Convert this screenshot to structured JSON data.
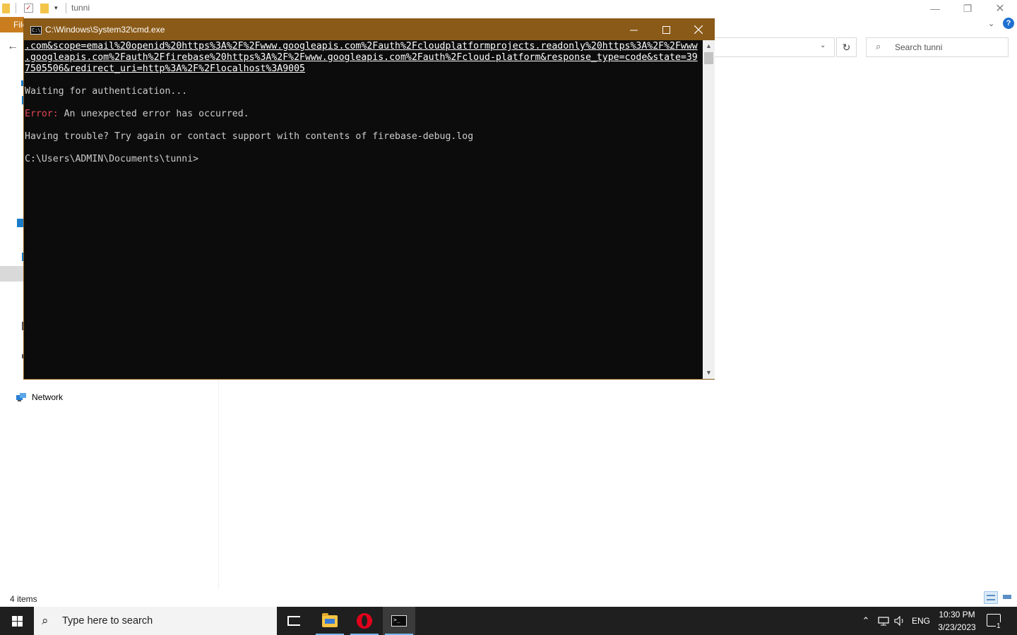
{
  "explorer": {
    "title": "tunni",
    "ribbon_file_label": "File",
    "search_placeholder": "Search tunni",
    "nav_network_label": "Network",
    "status_items": "4 items"
  },
  "cmd": {
    "title": "C:\\Windows\\System32\\cmd.exe",
    "url_line_1": ".com&scope=email%20openid%20https%3A%2F%2Fwww.googleapis.com%2Fauth%2Fcloudplatformprojects.readonly%20https%3A%2F%2Fwww",
    "url_line_2": ".googleapis.com%2Fauth%2Ffirebase%20https%3A%2F%2Fwww.googleapis.com%2Fauth%2Fcloud-platform&response_type=code&state=39",
    "url_line_3": "7505506&redirect_uri=http%3A%2F%2Flocalhost%3A9005",
    "waiting": "Waiting for authentication...",
    "error_label": "Error:",
    "error_message": " An unexpected error has occurred.",
    "trouble": "Having trouble? Try again or contact support with contents of firebase-debug.log",
    "prompt": "C:\\Users\\ADMIN\\Documents\\tunni>"
  },
  "taskbar": {
    "search_placeholder": "Type here to search",
    "language": "ENG",
    "time": "10:30 PM",
    "date": "3/23/2023",
    "notification_count": "1"
  },
  "colors": {
    "cmd_frame": "#8a5a18",
    "cmd_background": "#0c0c0c",
    "cmd_text": "#cccccc",
    "cmd_error": "#e74856",
    "taskbar": "#1f1f1f",
    "ribbon_file": "#c97d1e"
  }
}
